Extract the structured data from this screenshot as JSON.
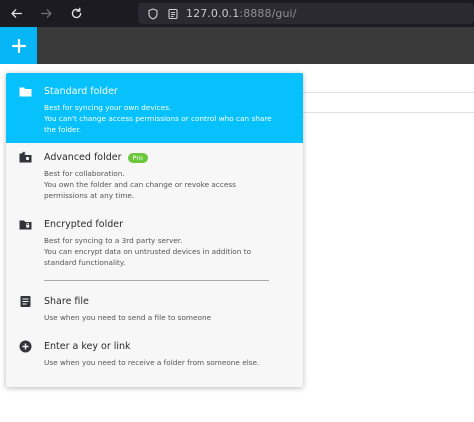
{
  "browser": {
    "url_host": "127.0.0.1",
    "url_rest": ":8888/gui/"
  },
  "menu": {
    "items": [
      {
        "title": "Standard folder",
        "desc": [
          "Best for syncing your own devices.",
          "You can't change access permissions or control who can share",
          "the folder."
        ],
        "icon": "folder-icon"
      },
      {
        "title": "Advanced folder",
        "badge": "Pro",
        "desc": [
          "Best for collaboration.",
          "You own the folder and can change or revoke access",
          "permissions at any time."
        ],
        "icon": "advanced-folder-icon"
      },
      {
        "title": "Encrypted folder",
        "desc": [
          "Best for syncing to a 3rd party server.",
          "You can encrypt data on untrusted devices in addition to",
          "standard functionality."
        ],
        "icon": "encrypted-folder-icon"
      },
      {
        "title": "Share file",
        "desc": [
          "Use when you need to send a file to someone"
        ],
        "icon": "file-icon"
      },
      {
        "title": "Enter a key or link",
        "desc": [
          "Use when you need to receive a folder from someone else."
        ],
        "icon": "plus-circle-icon"
      }
    ]
  },
  "colors": {
    "accent": "#06c1fb",
    "pro": "#6cc73b",
    "header": "#3a3a3a"
  }
}
